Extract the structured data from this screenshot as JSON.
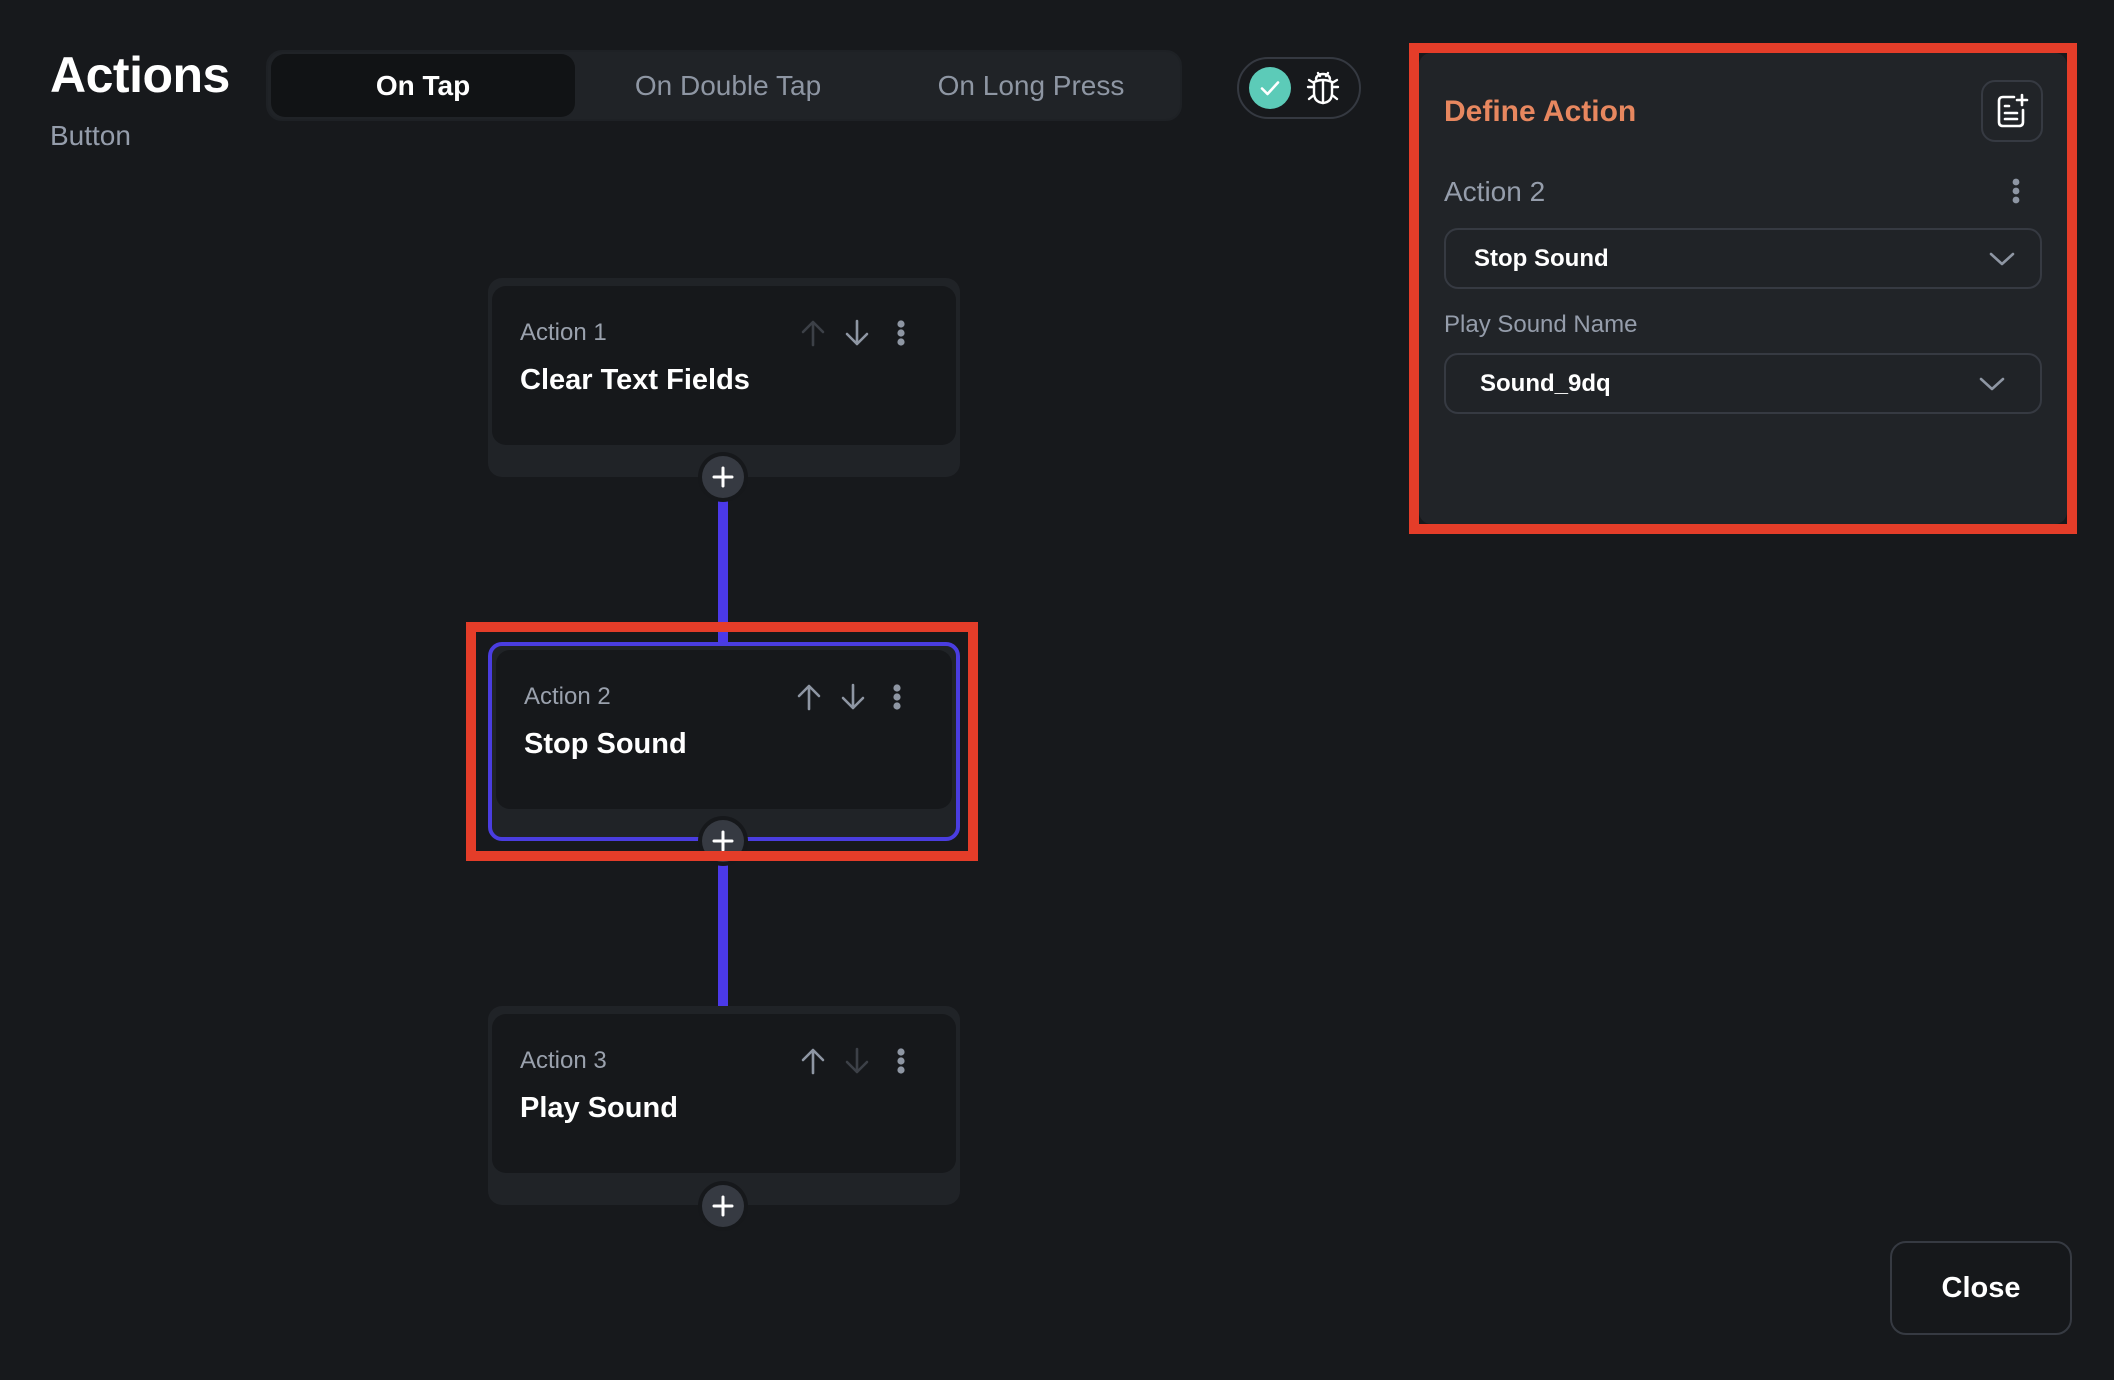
{
  "header": {
    "title": "Actions",
    "subtitle": "Button"
  },
  "tabs": [
    {
      "label": "On Tap",
      "active": true
    },
    {
      "label": "On Double Tap",
      "active": false
    },
    {
      "label": "On Long Press",
      "active": false
    }
  ],
  "toggle": {
    "icons": [
      "check-circle-icon",
      "bug-icon"
    ],
    "selected": "check"
  },
  "actions": [
    {
      "label": "Action 1",
      "title": "Clear Text Fields",
      "move_up_enabled": false,
      "move_down_enabled": true,
      "selected": false
    },
    {
      "label": "Action 2",
      "title": "Stop Sound",
      "move_up_enabled": true,
      "move_down_enabled": true,
      "selected": true
    },
    {
      "label": "Action 3",
      "title": "Play Sound",
      "move_up_enabled": true,
      "move_down_enabled": false,
      "selected": false
    }
  ],
  "panel": {
    "title": "Define Action",
    "action_label": "Action 2",
    "action_type": {
      "value": "Stop Sound"
    },
    "sound_field": {
      "label": "Play Sound Name",
      "value": "Sound_9dq"
    }
  },
  "footer": {
    "close_label": "Close"
  },
  "colors": {
    "background": "#17191c",
    "accent_connector": "#4b39e8",
    "selected_border": "#4a3de0",
    "panel_title": "#e7875f",
    "check": "#5ccbb8",
    "annotation_box": "#e43d29"
  }
}
